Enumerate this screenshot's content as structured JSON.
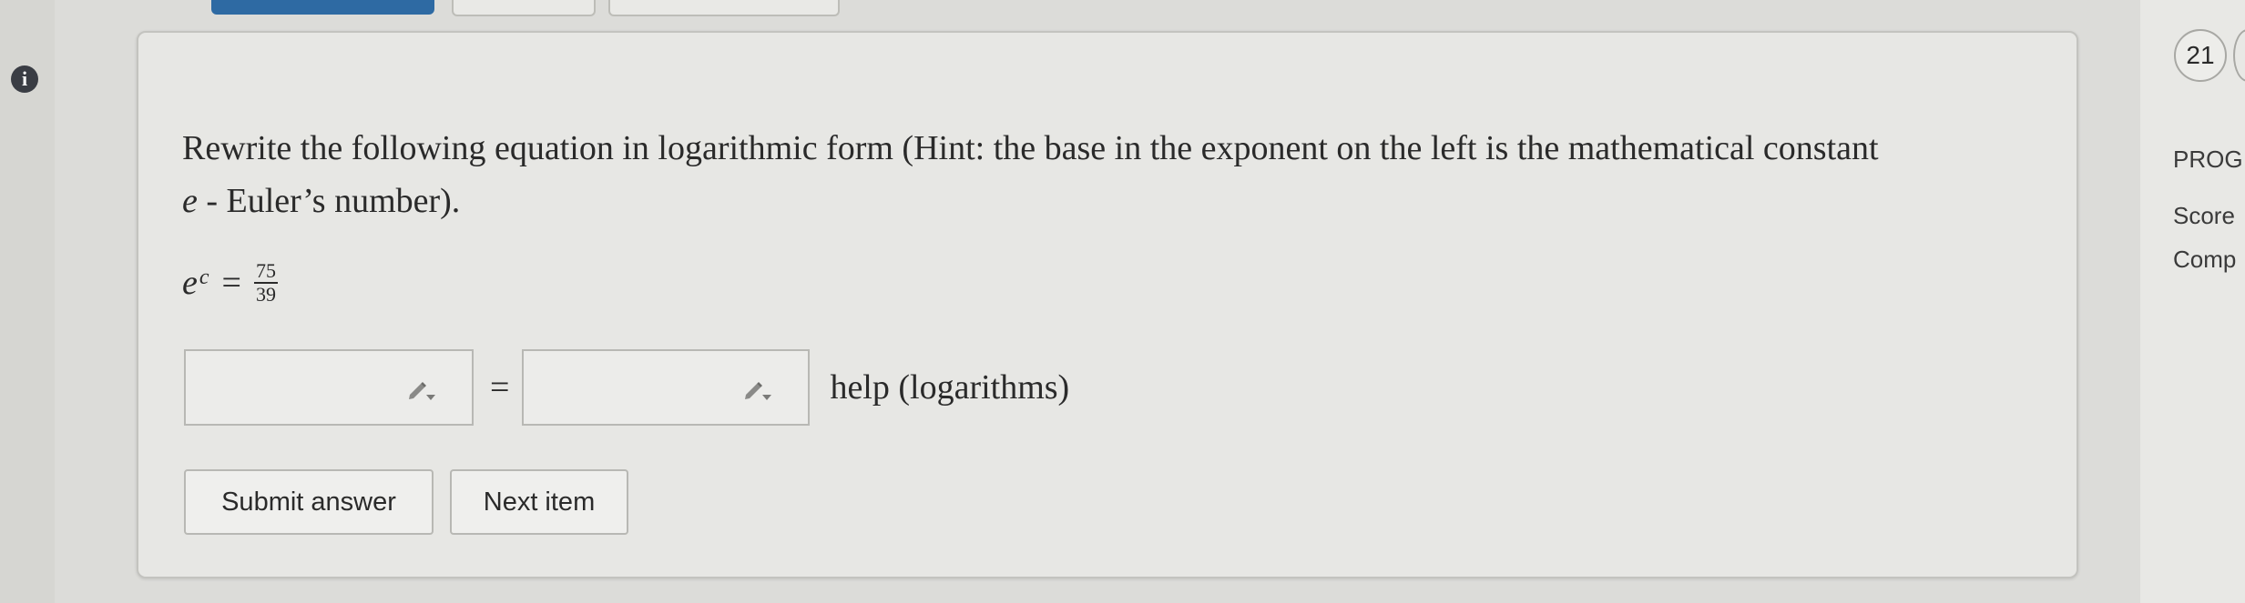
{
  "question": {
    "prompt_line1": "Rewrite the following equation in logarithmic form (Hint: the base in the exponent on the left is the mathematical constant",
    "prompt_line2_italic": "e",
    "prompt_line2_rest": " - Euler’s number).",
    "equation": {
      "base": "e",
      "exponent": "c",
      "equals": "=",
      "numerator": "75",
      "denominator": "39"
    }
  },
  "answer": {
    "left_value": "",
    "separator": "=",
    "right_value": "",
    "help_link": "help (logarithms)"
  },
  "buttons": {
    "submit": "Submit answer",
    "next": "Next item"
  },
  "side_panel": {
    "question_number": "21",
    "progress_label": "PROG",
    "score_label": "Score",
    "completed_label": "Comp"
  }
}
